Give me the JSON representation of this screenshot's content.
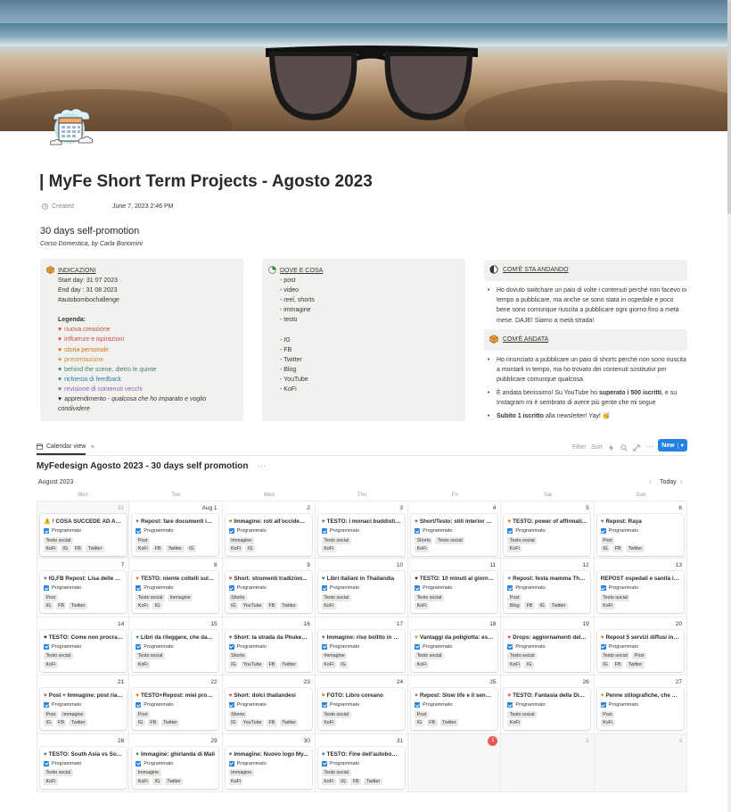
{
  "page": {
    "title": "| MyFe Short Term Projects - Agosto 2023",
    "created_label": "Created",
    "created_value": "June 7, 2023 2:46 PM",
    "heading": "30 days self-promotion",
    "subtitle": "Corso Domestica, by Carla Bonomini"
  },
  "indicazioni": {
    "head": "INDICAZIONI",
    "start": "Start day: 31 07 2023",
    "end": "End day :  31 08 2023",
    "hashtag": "#autobombochallenge",
    "legend_title": "Legenda:",
    "legend": [
      {
        "text": "nuova creazione",
        "color": "#c0583a"
      },
      {
        "text": "influenze e ispirazioni",
        "color": "#d44c47"
      },
      {
        "text": "storia personale",
        "color": "#d9730d"
      },
      {
        "text": "presentazione",
        "color": "#cb912f"
      },
      {
        "text": "behind the scene, dietro le quinte",
        "color": "#448361"
      },
      {
        "text": "richiesta di feedback",
        "color": "#337ea9"
      },
      {
        "text": "revisione di contenuti vecchi",
        "color": "#9065b0"
      }
    ],
    "legend_last_a": "apprendimento - ",
    "legend_last_b": "qualcosa che ho imparato e voglio",
    "legend_last_c": "condividere"
  },
  "dove": {
    "head": "DOVE E COSA",
    "items": [
      "- post",
      "- video",
      "- reel, shorts",
      "- immagine",
      "- testo",
      "",
      "- IG",
      "- FB",
      "- Twitter",
      "- Blog",
      "- YouTube",
      "- KoFi"
    ]
  },
  "come_sta": {
    "head": "COM'È STA ANDANDO",
    "bullet": "Ho dovuto switchare un paio di volte i contenuti perché non facevo in tempo a pubblicare, ma anche se sono stata in ospedale e poco bene sono comunque riuscita a pubblicare ogni giorno fino a metà mese. DAJE! Siamo a metà strada!"
  },
  "come_andata": {
    "head": "COM'È ANDATA",
    "b1": "Ho rinunciato a pubblicare un paio di shorts perché non sono riuscita a montarli in tempo, ma ho trovato dei contenuti sostitutivi per pubblicare comunque qualcosa",
    "b2_a": "È andata benissimo! Su YouTube ho ",
    "b2_b": "superato i 500 iscritti",
    "b2_c": ", e su Instagram mi è sembrato di avere più gente che mi segue",
    "b3_a": "Subito 1 iscritto",
    "b3_b": " alla newsletter! Yay! 🥳"
  },
  "toolbar": {
    "view_label": "Calendar view",
    "filter": "Filter",
    "sort": "Sort",
    "new": "New"
  },
  "calendar": {
    "title": "MyFedesign Agosto 2023 - 30 days self promotion",
    "month": "August 2023",
    "today": "Today",
    "status": "Programmato",
    "weekdays": [
      "Mon",
      "Tue",
      "Wed",
      "Thu",
      "Fri",
      "Sat",
      "Sun"
    ],
    "weeks": [
      [
        {
          "day": "31",
          "out": true,
          "title": "⚠️ ! COSA SUCCEDE AD AGO...",
          "tags1": [
            "Testo social"
          ],
          "tags2": [
            "KoFi",
            "IG",
            "FB",
            "Twitter"
          ]
        },
        {
          "day": "Aug 1",
          "heart": "#9065b0",
          "title": "Repost: fare documenti in ...",
          "tags1": [
            "Post"
          ],
          "tags2": [
            "KoFi",
            "FB",
            "Twitter",
            "IG"
          ]
        },
        {
          "day": "2",
          "heart": "#d9730d",
          "title": "Immagine: roti all'occident...",
          "tags1": [
            "Immagine"
          ],
          "tags2": [
            "KoFi",
            "IG"
          ]
        },
        {
          "day": "3",
          "heart": "#337ea9",
          "title": "TESTO: i monaci buddisti d...",
          "tags1": [
            "Testo social"
          ],
          "tags2": [
            "KoFi"
          ]
        },
        {
          "day": "4",
          "heart": "#d44c47",
          "title": "Short/Testo: stili interior d...",
          "tags1": [
            "Shorts",
            "Testo social"
          ],
          "tags2": [
            "KoFi"
          ]
        },
        {
          "day": "5",
          "heart": "#d9730d",
          "title": "TESTO: power of affirmati...",
          "tags1": [
            "Testo social"
          ],
          "tags2": [
            "KoFi"
          ]
        },
        {
          "day": "6",
          "heart": "#9065b0",
          "title": "Repost: Raya",
          "tags1": [
            "Post"
          ],
          "tags2": [
            "IG",
            "FB",
            "Twitter"
          ]
        }
      ],
      [
        {
          "day": "7",
          "heart": "#9065b0",
          "title": "IG,FB Repost: Lisa delle Bl...",
          "tags1": [
            "Post"
          ],
          "tags2": [
            "IG",
            "FB",
            "Twitter"
          ]
        },
        {
          "day": "8",
          "heart": "#d9730d",
          "title": "TESTO: niente coltelli sulle ...",
          "tags1": [
            "Testo social",
            "Immagine"
          ],
          "tags2": [
            "KoFi",
            "IG"
          ]
        },
        {
          "day": "9",
          "heart": "#d44c47",
          "title": "Short: strumenti tradizion...",
          "tags1": [
            "Shorts"
          ],
          "tags2": [
            "IG",
            "YouTube",
            "FB",
            "Twitter"
          ]
        },
        {
          "day": "10",
          "heart": "#448361",
          "title": "Libri italiani in Thailandia",
          "tags1": [
            "Testo social"
          ],
          "tags2": [
            "KoFi"
          ]
        },
        {
          "day": "11",
          "heart": "#2b2a27",
          "title": "TESTO: 10 minuti al giorno...",
          "tags1": [
            "Testo social"
          ],
          "tags2": [
            "KoFi"
          ]
        },
        {
          "day": "12",
          "heart": "#9065b0",
          "title": "Repost: festa mamma Thai...",
          "tags1": [
            "Post"
          ],
          "tags2": [
            "Blog",
            "FB",
            "IG",
            "Twitter"
          ]
        },
        {
          "day": "13",
          "title": "REPOST ospedali e sanità in T...",
          "tags1": [
            "Testo social"
          ],
          "tags2": [
            "KoFi"
          ]
        }
      ],
      [
        {
          "day": "14",
          "heart": "#2b2a27",
          "title": "TESTO: Come non procrast...",
          "tags1": [
            "Testo social"
          ],
          "tags2": [
            "KoFi"
          ]
        },
        {
          "day": "15",
          "heart": "#337ea9",
          "title": "Libri da rileggere, che dan...",
          "tags1": [
            "Testo social"
          ],
          "tags2": [
            "KoFi"
          ]
        },
        {
          "day": "16",
          "heart": "#448361",
          "title": "Short: la strada da Phuket ...",
          "tags1": [
            "Shorts"
          ],
          "tags2": [
            "IG",
            "YouTube",
            "FB",
            "Twitter"
          ]
        },
        {
          "day": "17",
          "heart": "#448361",
          "title": "Immagine: riso bollito in o...",
          "tags1": [
            "Immagine"
          ],
          "tags2": [
            "KoFi",
            "IG"
          ]
        },
        {
          "day": "18",
          "heart": "#cb912f",
          "title": "Vantaggi da poliglotta: ess...",
          "tags1": [
            "Testo social"
          ],
          "tags2": [
            "KoFi"
          ]
        },
        {
          "day": "19",
          "heart": "#d44c47",
          "title": "Drops: aggiornamenti dell'...",
          "tags1": [
            "Testo social"
          ],
          "tags2": [
            "KoFi",
            "IG"
          ]
        },
        {
          "day": "20",
          "heart": "#d9730d",
          "title": "Repost 5 servizi diffusi in T...",
          "tags1": [
            "Testo social",
            "Post"
          ],
          "tags2": [
            "IG",
            "FB",
            "Twitter"
          ]
        }
      ],
      [
        {
          "day": "21",
          "heart": "#c0583a",
          "title": "Post + Immagine: post rias...",
          "tags1": [
            "Post",
            "Immagine"
          ],
          "tags2": [
            "IG",
            "FB",
            "Twitter"
          ]
        },
        {
          "day": "22",
          "heart": "#d9730d",
          "title": "TESTO+Repost: miei probl...",
          "tags1": [
            "Post"
          ],
          "tags2": [
            "IG",
            "FB",
            "Twitter"
          ]
        },
        {
          "day": "23",
          "heart": "#d44c47",
          "title": "Short: dolci thailandesi",
          "tags1": [
            "Shorts"
          ],
          "tags2": [
            "IG",
            "YouTube",
            "FB",
            "Twitter"
          ]
        },
        {
          "day": "24",
          "heart": "#d9730d",
          "title": "FOTO: Libro coreano",
          "tags1": [
            "Testo social"
          ],
          "tags2": [
            "KoFi"
          ]
        },
        {
          "day": "25",
          "heart": "#9065b0",
          "title": "Repost: Slow life e il senso...",
          "tags1": [
            "Post"
          ],
          "tags2": [
            "IG",
            "FB",
            "Twitter"
          ]
        },
        {
          "day": "26",
          "heart": "#d44c47",
          "title": "TESTO: Fantasia della Disney",
          "tags1": [
            "Testo social"
          ],
          "tags2": [
            "KoFi"
          ]
        },
        {
          "day": "27",
          "heart": "#cb912f",
          "title": "Penne stilografiche, che pa...",
          "tags1": [
            "Post"
          ],
          "tags2": [
            "KoFi"
          ]
        }
      ],
      [
        {
          "day": "28",
          "heart": "#448361",
          "title": "TESTO: South Asia vs Sout...",
          "tags1": [
            "Testo social"
          ],
          "tags2": [
            "KoFi"
          ]
        },
        {
          "day": "29",
          "heart": "#448361",
          "title": "Immagine: ghirlanda di Mali",
          "tags1": [
            "Immagine"
          ],
          "tags2": [
            "KoFi",
            "IG",
            "Twitter"
          ]
        },
        {
          "day": "30",
          "heart": "#448361",
          "title": "Immagine: Nuovo logo My...",
          "tags1": [
            "Immagine"
          ],
          "tags2": [
            "KoFi"
          ]
        },
        {
          "day": "31",
          "heart": "#337ea9",
          "title": "TESTO: Fine dell'autobomb...",
          "tags1": [
            "Testo social"
          ],
          "tags2": [
            "KoFi",
            "IG",
            "FB",
            "Twitter"
          ]
        },
        {
          "day": "1",
          "out": true,
          "today": true
        },
        {
          "day": "2",
          "out": true
        },
        {
          "day": "3",
          "out": true
        }
      ]
    ]
  }
}
